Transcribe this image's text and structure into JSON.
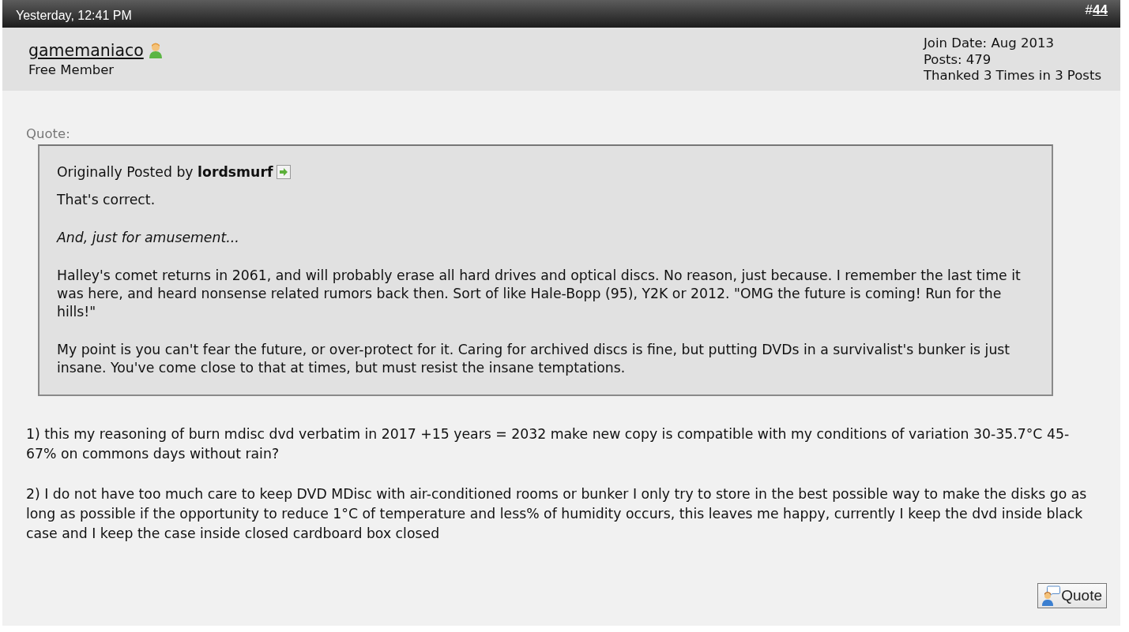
{
  "post_header": {
    "date": "Yesterday, 12:41 PM",
    "number_prefix": "#",
    "number": "44"
  },
  "user": {
    "name": "gamemaniaco",
    "online": true,
    "title": "Free Member",
    "stats": [
      "Join Date: Aug 2013",
      "Posts: 479",
      "Thanked 3 Times in 3 Posts"
    ]
  },
  "quote": {
    "label": "Quote:",
    "attribution": "Originally Posted by",
    "author": "lordsmurf",
    "paragraphs": [
      {
        "text": "That's correct.",
        "italic": false
      },
      {
        "text": "And, just for amusement...",
        "italic": true
      },
      {
        "text": "Halley's comet returns in 2061, and will probably erase all hard drives and optical discs. No reason, just because. I remember the last time it was here, and heard nonsense related rumors back then. Sort of like Hale-Bopp (95), Y2K or 2012. \"OMG the future is coming! Run for the hills!\"",
        "italic": false
      },
      {
        "text": "My point is you can't fear the future, or over-protect for it. Caring for archived discs is fine, but putting DVDs in a survivalist's bunker is just insane. You've come close to that at times, but must resist the insane temptations.",
        "italic": false
      }
    ]
  },
  "message": {
    "paragraphs": [
      "1) this my reasoning of burn mdisc dvd verbatim in 2017 +15 years = 2032 make new copy is compatible with my conditions of variation 30-35.7°C 45-67% on commons days without rain?",
      "2) I do not have too much care to keep DVD MDisc with air-conditioned rooms or bunker I only try to store in the best possible way to make the disks go as long as possible if the opportunity to reduce 1°C of temperature and less% of humidity occurs, this leaves me happy, currently I keep the dvd inside black case and I keep the case inside closed cardboard box closed"
    ]
  },
  "buttons": [
    {
      "label": "Quote"
    }
  ]
}
